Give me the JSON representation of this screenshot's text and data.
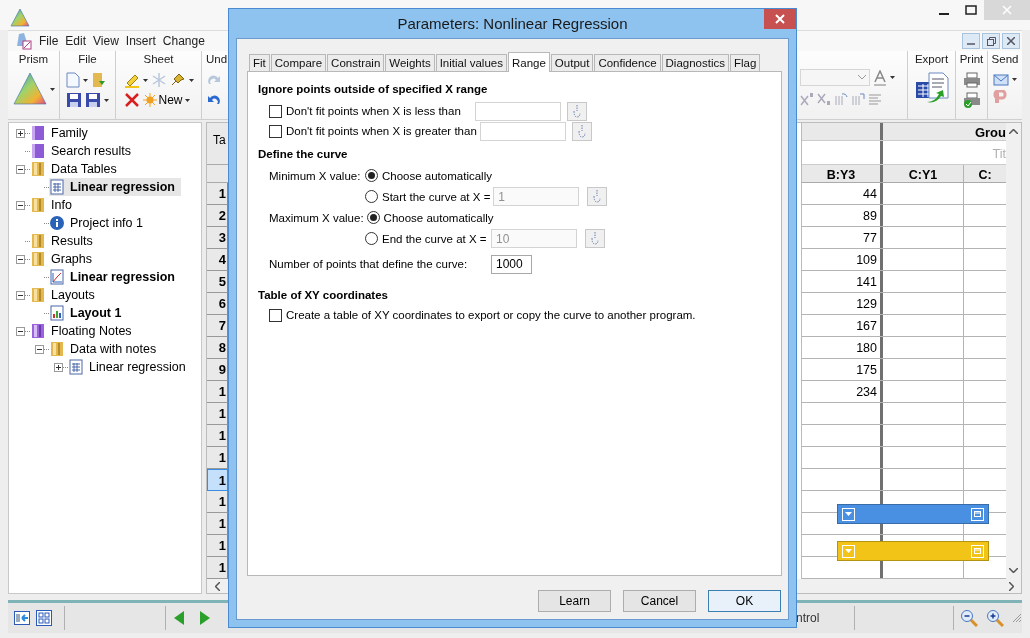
{
  "app": {
    "menu": [
      "File",
      "Edit",
      "View",
      "Insert",
      "Change"
    ]
  },
  "ribbon": {
    "left_groups": [
      "Prism",
      "File",
      "Sheet",
      "Und"
    ],
    "new_button": "New",
    "right_groups": [
      "Export",
      "Print",
      "Send"
    ]
  },
  "tree": [
    {
      "label": "Family",
      "kind": "book",
      "expandable": true,
      "expanded": false,
      "emphasized": false,
      "selected": false
    },
    {
      "label": "Search results",
      "kind": "book",
      "expandable": false,
      "expanded": false,
      "emphasized": false,
      "selected": false
    },
    {
      "label": "Data Tables",
      "kind": "folder",
      "expandable": true,
      "expanded": true,
      "emphasized": false,
      "selected": false,
      "children": [
        {
          "label": "Linear regression",
          "kind": "table",
          "expandable": false,
          "expanded": false,
          "emphasized": true,
          "selected": true
        }
      ]
    },
    {
      "label": "Info",
      "kind": "folder",
      "expandable": true,
      "expanded": true,
      "emphasized": false,
      "selected": false,
      "children": [
        {
          "label": "Project info 1",
          "kind": "info",
          "expandable": false,
          "expanded": false,
          "emphasized": false,
          "selected": false
        }
      ]
    },
    {
      "label": "Results",
      "kind": "folder",
      "expandable": false,
      "expanded": false,
      "emphasized": false,
      "selected": false
    },
    {
      "label": "Graphs",
      "kind": "folder",
      "expandable": true,
      "expanded": true,
      "emphasized": false,
      "selected": false,
      "children": [
        {
          "label": "Linear regression",
          "kind": "graph",
          "expandable": false,
          "expanded": false,
          "emphasized": true,
          "selected": false
        }
      ]
    },
    {
      "label": "Layouts",
      "kind": "folder",
      "expandable": true,
      "expanded": true,
      "emphasized": false,
      "selected": false,
      "children": [
        {
          "label": "Layout 1",
          "kind": "layout",
          "expandable": false,
          "expanded": false,
          "emphasized": true,
          "selected": false
        }
      ]
    },
    {
      "label": "Floating Notes",
      "kind": "note-folder",
      "expandable": true,
      "expanded": true,
      "emphasized": false,
      "selected": false,
      "children": [
        {
          "label": "Data with notes",
          "kind": "folder",
          "expandable": true,
          "expanded": true,
          "emphasized": false,
          "selected": false,
          "children": [
            {
              "label": "Linear regression",
              "kind": "table",
              "expandable": true,
              "expanded": false,
              "emphasized": false,
              "selected": false
            }
          ]
        }
      ]
    }
  ],
  "sheet": {
    "corner": "Ta",
    "group_header": "Grou",
    "title_field": {
      "placeholder": "Tit"
    },
    "columns": [
      "B:Y3",
      "C:Y1",
      "C:"
    ],
    "values": [
      "44",
      "89",
      "77",
      "109",
      "141",
      "129",
      "167",
      "180",
      "175",
      "234"
    ],
    "row_numbers": [
      {
        "label": "1",
        "selected": false
      },
      {
        "label": "2",
        "selected": false
      },
      {
        "label": "3",
        "selected": false
      },
      {
        "label": "4",
        "selected": false
      },
      {
        "label": "5",
        "selected": false
      },
      {
        "label": "6",
        "selected": false
      },
      {
        "label": "7",
        "selected": false
      },
      {
        "label": "8",
        "selected": false
      },
      {
        "label": "9",
        "selected": false
      },
      {
        "label": "1",
        "selected": false
      },
      {
        "label": "1",
        "selected": false
      },
      {
        "label": "1",
        "selected": false
      },
      {
        "label": "1",
        "selected": false
      },
      {
        "label": "1",
        "selected": true
      },
      {
        "label": "1",
        "selected": false
      },
      {
        "label": "1",
        "selected": false
      },
      {
        "label": "1",
        "selected": false
      },
      {
        "label": "1",
        "selected": false
      }
    ],
    "notes": [
      {
        "color": "#4a90e2"
      },
      {
        "color": "#f2c418"
      }
    ]
  },
  "status": {
    "text": "ntrol"
  },
  "dialog": {
    "title": "Parameters: Nonlinear Regression",
    "tabs": [
      {
        "label": "Fit",
        "selected": false
      },
      {
        "label": "Compare",
        "selected": false
      },
      {
        "label": "Constrain",
        "selected": false
      },
      {
        "label": "Weights",
        "selected": false
      },
      {
        "label": "Initial values",
        "selected": false
      },
      {
        "label": "Range",
        "selected": true
      },
      {
        "label": "Output",
        "selected": false
      },
      {
        "label": "Confidence",
        "selected": false
      },
      {
        "label": "Diagnostics",
        "selected": false
      },
      {
        "label": "Flag",
        "selected": false
      }
    ],
    "ignore_heading": "Ignore points outside of specified X range",
    "ignore_rows": [
      {
        "label": "Don't fit points when X is less than",
        "checked": false
      },
      {
        "label": "Don't fit points when X is greater than",
        "checked": false
      }
    ],
    "curve_heading": "Define the curve",
    "limits": [
      {
        "label": "Minimum X value:",
        "options": [
          {
            "label": "Choose automatically",
            "selected": true
          },
          {
            "label": "Start the curve at X =",
            "selected": false,
            "value": "1"
          }
        ]
      },
      {
        "label": "Maximum X value:",
        "options": [
          {
            "label": "Choose automatically",
            "selected": true
          },
          {
            "label": "End the curve at X =",
            "selected": false,
            "value": "10"
          }
        ]
      }
    ],
    "points": {
      "label": "Number of points that define the curve:",
      "value": "1000"
    },
    "table_heading": "Table of XY coordinates",
    "table_option": {
      "label": "Create a table of XY coordinates to export or copy the curve to another program.",
      "checked": false
    },
    "buttons": [
      "Learn",
      "Cancel",
      "OK"
    ]
  }
}
